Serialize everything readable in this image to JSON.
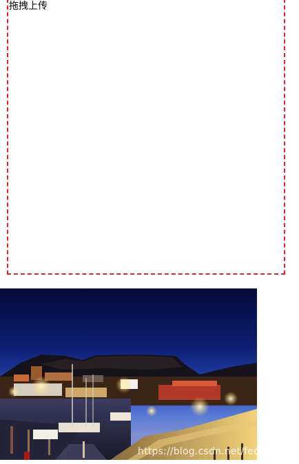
{
  "drop_zone": {
    "label": "拖拽上传",
    "border_color": "#e3242b"
  },
  "preview_image": {
    "watermark": "https://blog.csdn.net/fed_guanqi"
  }
}
